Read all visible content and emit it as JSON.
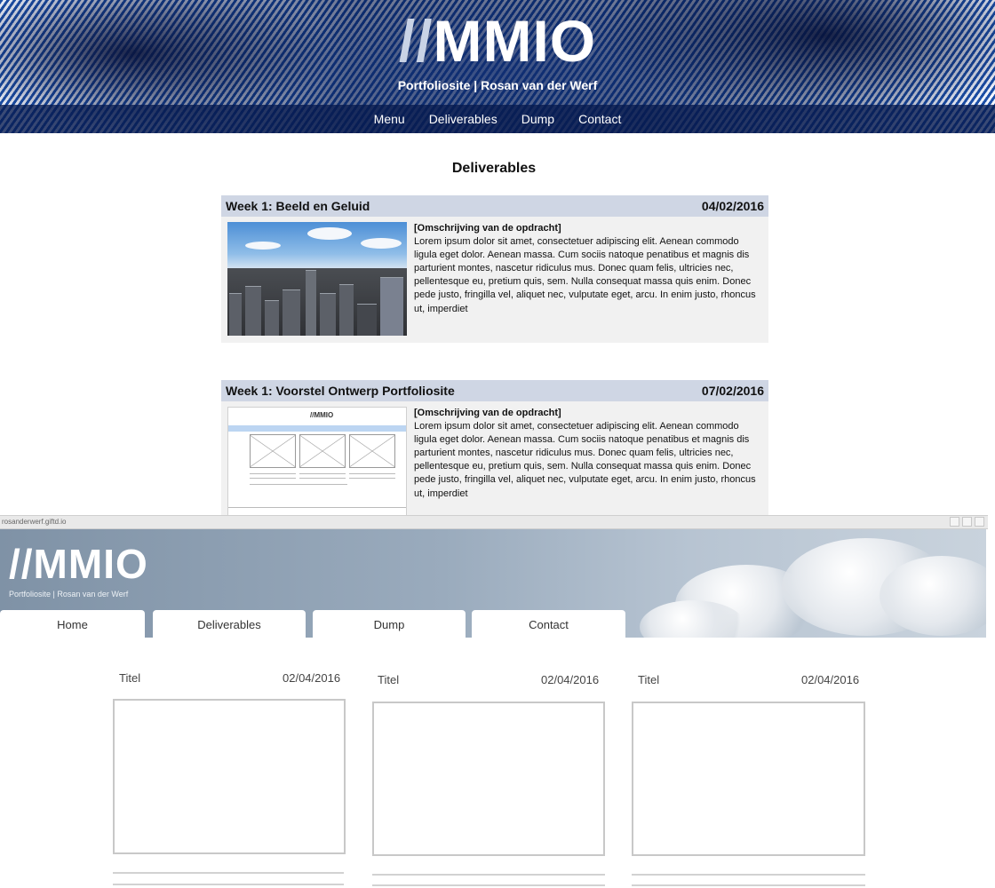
{
  "site": {
    "logo_slashes": "//",
    "logo_text": "MMIO",
    "subtitle": "Portfoliosite | Rosan van der Werf",
    "nav": [
      "Menu",
      "Deliverables",
      "Dump",
      "Contact"
    ]
  },
  "deliverables": {
    "title": "Deliverables",
    "items": [
      {
        "title": "Week 1: Beeld en Geluid",
        "date": "04/02/2016",
        "lead": "[Omschrijving van de opdracht]",
        "body": "Lorem ipsum dolor sit amet, consectetuer adipiscing elit. Aenean commodo ligula eget dolor. Aenean massa. Cum sociis natoque penatibus et magnis dis parturient montes, nascetur ridiculus mus. Donec quam felis, ultricies nec, pellentesque eu, pretium quis, sem. Nulla consequat massa quis enim. Donec pede justo, fringilla vel, aliquet nec, vulputate eget, arcu. In enim justo, rhoncus ut, imperdiet"
      },
      {
        "title": "Week 1: Voorstel Ontwerp Portfoliosite",
        "date": "07/02/2016",
        "lead": "[Omschrijving van de opdracht]",
        "body": "Lorem ipsum dolor sit amet, consectetuer adipiscing elit. Aenean commodo ligula eget dolor. Aenean massa. Cum sociis natoque penatibus et magnis dis parturient montes, nascetur ridiculus mus. Donec quam felis, ultricies nec, pellentesque eu, pretium quis, sem. Nulla consequat massa quis enim. Donec pede justo, fringilla vel, aliquet nec, vulputate eget, arcu. In enim justo, rhoncus ut, imperdiet"
      }
    ],
    "wireframe_logo": "//MMIO"
  },
  "mockup": {
    "window_url": "rosanderwerf.giftd.io",
    "logo": "//MMIO",
    "subtitle": "Portfoliosite | Rosan van der Werf",
    "tabs": [
      "Home",
      "Deliverables",
      "Dump",
      "Contact"
    ],
    "columns": [
      {
        "title": "Titel",
        "date": "02/04/2016"
      },
      {
        "title": "Titel",
        "date": "02/04/2016"
      },
      {
        "title": "Titel",
        "date": "02/04/2016"
      }
    ]
  }
}
